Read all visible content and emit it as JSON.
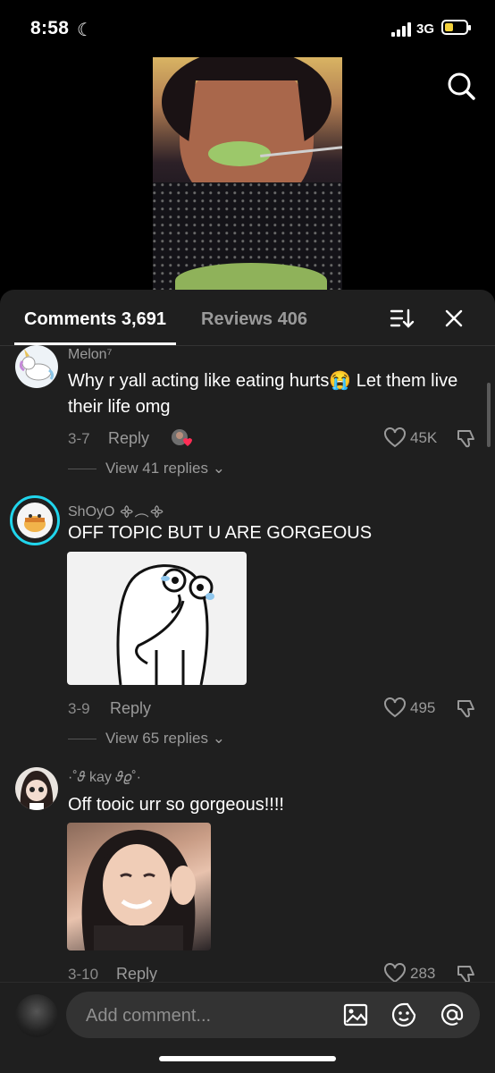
{
  "status": {
    "time": "8:58",
    "network": "3G"
  },
  "tabs": [
    {
      "label": "Comments 3,691",
      "active": true
    },
    {
      "label": "Reviews 406",
      "active": false
    }
  ],
  "comments": [
    {
      "username": "Melon⁷",
      "text": "Why r yall acting like eating hurts😭 Let them live their life omg",
      "date": "3-7",
      "reply_label": "Reply",
      "likes": "45K",
      "view_replies": "View 41 replies"
    },
    {
      "username": "ShOyO ᯽︵᯽",
      "text": "OFF TOPIC BUT U ARE GORGEOUS",
      "date": "3-9",
      "reply_label": "Reply",
      "likes": "495",
      "view_replies": "View 65 replies"
    },
    {
      "username": "·˚𝜗 kay 𝜗𝜚˚·",
      "text": "Off tooic urr so gorgeous!!!!",
      "date": "3-10",
      "reply_label": "Reply",
      "likes": "283"
    }
  ],
  "compose": {
    "placeholder": "Add comment..."
  },
  "colors": {
    "sheet_bg": "#1f1f1f",
    "accent_ring": "#20d5ec"
  },
  "icons": [
    "search-icon",
    "sort-icon",
    "close-icon",
    "heart-icon",
    "dislike-icon",
    "image-icon",
    "emoji-icon",
    "mention-icon"
  ]
}
